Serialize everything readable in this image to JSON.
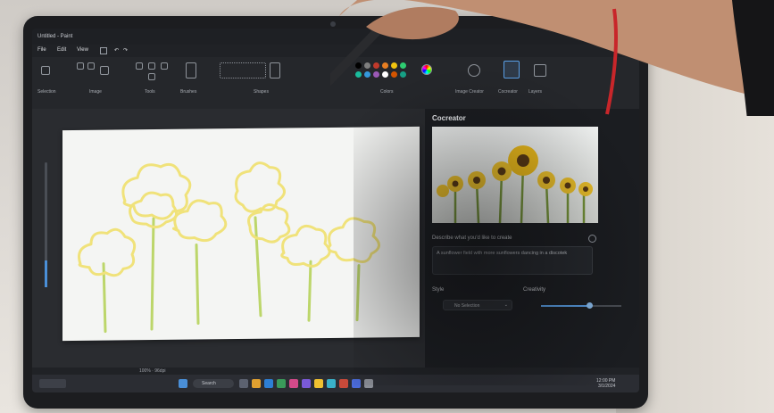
{
  "window": {
    "title": "Untitled - Paint"
  },
  "menu": {
    "file": "File",
    "edit": "Edit",
    "view": "View"
  },
  "ribbon": {
    "groups": [
      "Selection",
      "Image",
      "Tools",
      "Brushes",
      "Shapes",
      "Colors",
      "Image Creator",
      "Cocreator",
      "Layers"
    ]
  },
  "colors": {
    "swatches": [
      "#000000",
      "#7f7f7f",
      "#c0392b",
      "#e67e22",
      "#f1c40f",
      "#2ecc71",
      "#1abc9c",
      "#3498db",
      "#9b59b6",
      "#ffffff",
      "#d35400",
      "#16a085"
    ],
    "accent": "#4a8fd8",
    "sketch_yellow": "#f0e27a",
    "stem_green": "#bcd66a"
  },
  "cocreator": {
    "title": "Cocreator",
    "describe_label": "Describe what you'd like to create",
    "prompt": "A sunflower field with more sunflowers dancing in a discotek",
    "style_label": "Style",
    "style_value": "No Selection",
    "creativity_label": "Creativity",
    "creativity_level": 0.6
  },
  "status": {
    "zoom_text": "100% · 96dpi"
  },
  "taskbar": {
    "search_placeholder": "Search",
    "time": "12:00 PM",
    "date": "3/1/2024"
  }
}
